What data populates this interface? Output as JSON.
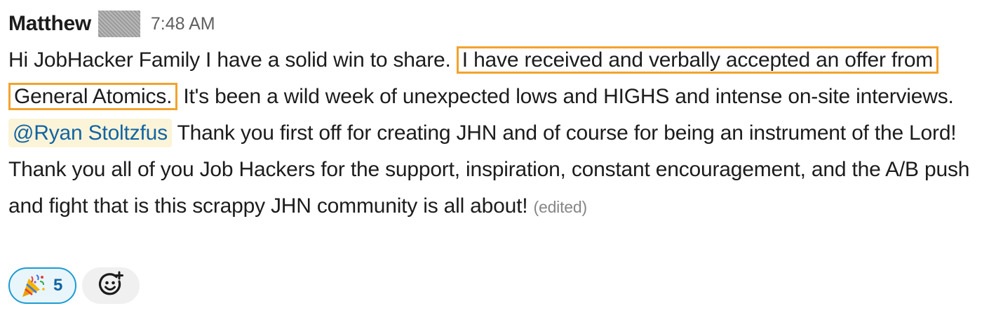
{
  "message": {
    "author": "Matthew",
    "timestamp": "7:48 AM",
    "text": {
      "before": "Hi JobHacker Family I have a solid win to share. ",
      "highlight": "I have received and verbally accepted an offer from General Atomics.",
      "middle": " It's been a wild week of unexpected lows and HIGHS and intense on-site interviews.  ",
      "mention": "@Ryan Stoltzfus",
      "after": " Thank you first off for creating JHN and of course for being an instrument of the Lord!  Thank you all of you Job Hackers for the support, inspiration, constant encouragement, and the A/B push and fight that is this scrappy JHN community is all about! ",
      "edited": "(edited)"
    },
    "reactions": [
      {
        "emoji": "party-popper-icon",
        "count": "5"
      }
    ],
    "add_reaction_icon": "add-emoji-icon"
  },
  "colors": {
    "highlight_border": "#f2a32c",
    "mention_bg": "#fcf4d9",
    "mention_text": "#1264a3",
    "reaction_border": "#1d9bd1"
  }
}
